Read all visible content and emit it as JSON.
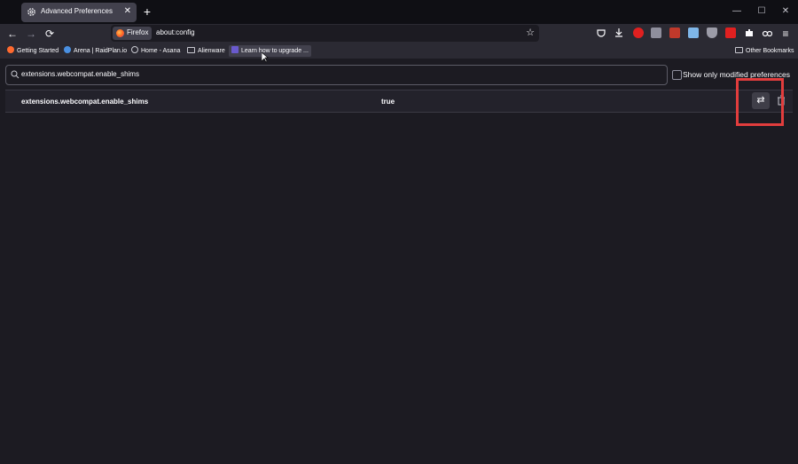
{
  "tab": {
    "title": "Advanced Preferences",
    "icon": "gear-icon",
    "close": "✕"
  },
  "toolbar": {
    "new_tab": "+",
    "back_icon": "←",
    "forward_icon": "→",
    "reload_icon": "⟳",
    "identity_label": "Firefox",
    "url": "about:config",
    "bookmark_star": "☆"
  },
  "window_controls": {
    "minimize": "—",
    "maximize": "☐",
    "close": "✕"
  },
  "extensions": {
    "menu_icon": "≡",
    "colors": [
      "#c8c8d0",
      "#c8c8d0",
      "#e02020",
      "#c8c8d0",
      "#e02020",
      "#7fb6e8",
      "#c8c8d0",
      "#e02020",
      "#c8c8d0",
      "#c8c8d0"
    ]
  },
  "bookmarks": {
    "items": [
      {
        "label": "Getting Started",
        "icon": "firefox-icon",
        "color": "#ff6a2f"
      },
      {
        "label": "Arena | RaidPlan.io",
        "icon": "raidplan-icon",
        "color": "#4a90e2"
      },
      {
        "label": "Home - Asana",
        "icon": "globe-icon",
        "color": "#c8c8d0"
      },
      {
        "label": "Alienware",
        "icon": "folder-icon",
        "color": "#c8c8d0"
      },
      {
        "label": "Learn how to upgrade ...",
        "icon": "page-icon",
        "color": "#6a5acd"
      }
    ],
    "other": "Other Bookmarks"
  },
  "config": {
    "search_value": "extensions.webcompat.enable_shims",
    "show_modified_label": "Show only modified preferences",
    "pref_name": "extensions.webcompat.enable_shims",
    "pref_value": "true",
    "toggle_icon": "⇄",
    "highlight_color": "#e23d3d"
  }
}
